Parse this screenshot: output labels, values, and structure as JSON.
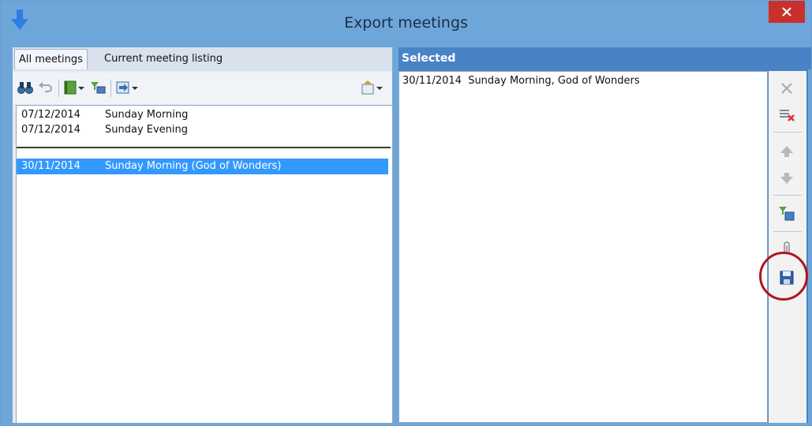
{
  "window": {
    "title": "Export meetings",
    "close_icon": "close-icon",
    "app_icon": "down-arrow-icon"
  },
  "left": {
    "tabs": [
      {
        "label": "All meetings"
      },
      {
        "label": "Current meeting listing"
      }
    ],
    "toolbar_icons": [
      "binoculars-icon",
      "undo-icon",
      "book-icon",
      "filter-icon",
      "export-icon",
      "properties-icon"
    ],
    "meetings": [
      {
        "date": "07/12/2014",
        "name": "Sunday Morning"
      },
      {
        "date": "07/12/2014",
        "name": "Sunday Evening"
      }
    ],
    "past_meetings": [
      {
        "date": "30/11/2014",
        "name": "Sunday Morning (God of Wonders)"
      }
    ]
  },
  "right": {
    "header": "Selected",
    "items": [
      {
        "label": "30/11/2014  Sunday Morning, God of Wonders"
      }
    ],
    "side_tools": [
      "remove-icon",
      "remove-all-icon",
      "move-up-icon",
      "move-down-icon",
      "add-filtered-icon",
      "attach-icon",
      "save-icon"
    ]
  }
}
